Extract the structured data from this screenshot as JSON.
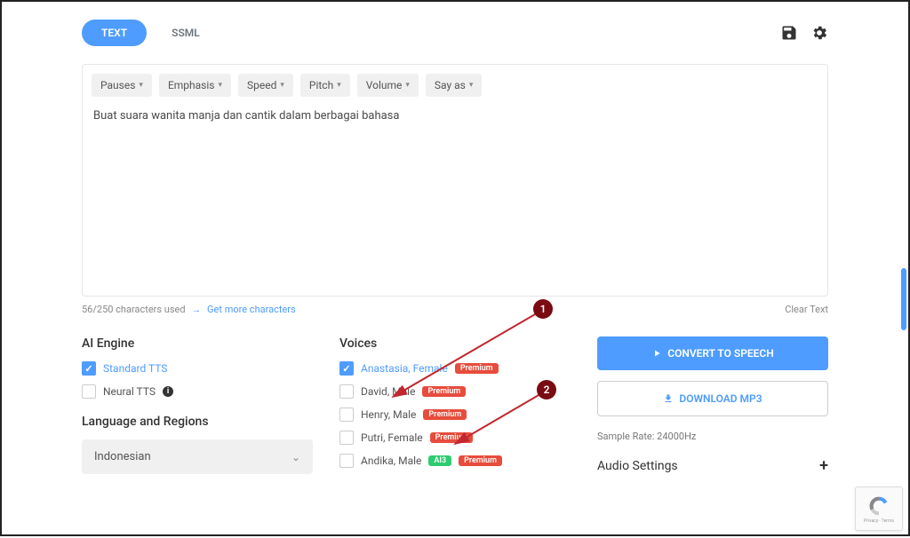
{
  "tabs": {
    "text": "TEXT",
    "ssml": "SSML"
  },
  "toolbar": {
    "pauses": "Pauses",
    "emphasis": "Emphasis",
    "speed": "Speed",
    "pitch": "Pitch",
    "volume": "Volume",
    "sayas": "Say as"
  },
  "textarea_value": "Buat suara wanita manja dan cantik dalam berbagai bahasa",
  "char_count": "56/250 characters used",
  "get_more": "Get more characters",
  "clear_text": "Clear Text",
  "ai_engine": {
    "title": "AI Engine",
    "standard": "Standard TTS",
    "neural": "Neural TTS"
  },
  "lang": {
    "title": "Language and Regions",
    "selected": "Indonesian"
  },
  "voices": {
    "title": "Voices",
    "list": [
      {
        "name": "Anastasia, Female",
        "checked": true,
        "badges": [
          "Premium"
        ]
      },
      {
        "name": "David, Male",
        "checked": false,
        "badges": [
          "Premium"
        ]
      },
      {
        "name": "Henry, Male",
        "checked": false,
        "badges": [
          "Premium"
        ]
      },
      {
        "name": "Putri, Female",
        "checked": false,
        "badges": [
          "Premium"
        ]
      },
      {
        "name": "Andika, Male",
        "checked": false,
        "badges": [
          "AI3",
          "Premium"
        ]
      }
    ]
  },
  "actions": {
    "convert": "CONVERT TO SPEECH",
    "download": "DOWNLOAD MP3"
  },
  "sample_rate": "Sample Rate: 24000Hz",
  "audio_settings": "Audio Settings",
  "annot": {
    "n1": "1",
    "n2": "2"
  },
  "recaptcha": "Privacy - Terms"
}
